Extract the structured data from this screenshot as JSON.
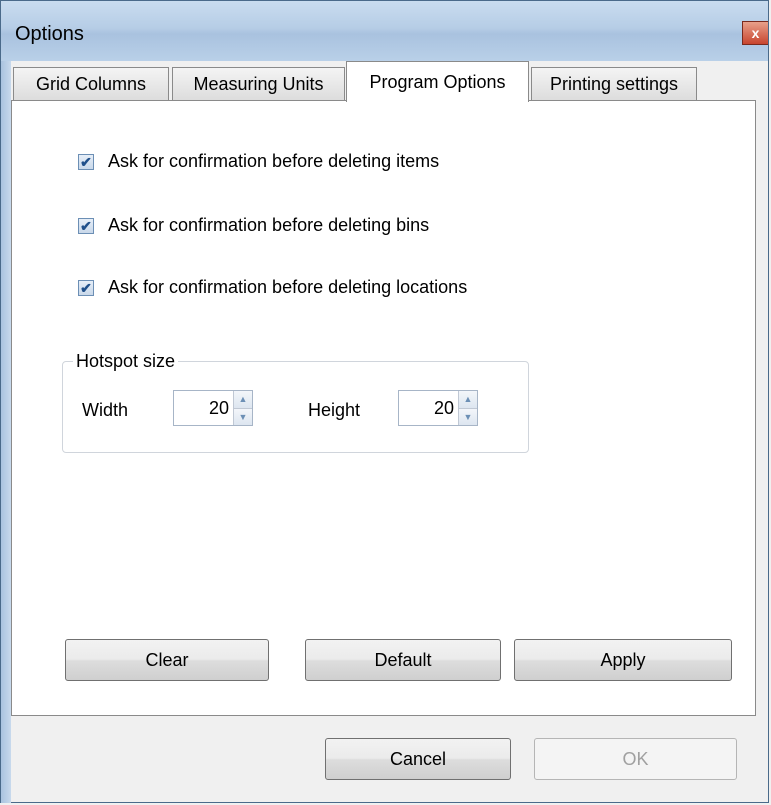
{
  "window": {
    "title": "Options",
    "close_glyph": "x"
  },
  "tabs": [
    {
      "label": "Grid Columns",
      "active": false
    },
    {
      "label": "Measuring Units",
      "active": false
    },
    {
      "label": "Program Options",
      "active": true
    },
    {
      "label": "Printing settings",
      "active": false
    }
  ],
  "program_options": {
    "checkboxes": [
      {
        "label": "Ask for confirmation before deleting items",
        "checked": true
      },
      {
        "label": "Ask for confirmation before deleting bins",
        "checked": true
      },
      {
        "label": "Ask for confirmation before deleting locations",
        "checked": true
      }
    ],
    "hotspot": {
      "legend": "Hotspot size",
      "width_label": "Width",
      "width_value": "20",
      "height_label": "Height",
      "height_value": "20"
    },
    "buttons": {
      "clear": "Clear",
      "default": "Default",
      "apply": "Apply"
    }
  },
  "dialog_buttons": {
    "cancel": "Cancel",
    "ok": "OK",
    "ok_enabled": false
  },
  "icons": {
    "check": "✔",
    "spin_up": "▲",
    "spin_down": "▼"
  }
}
